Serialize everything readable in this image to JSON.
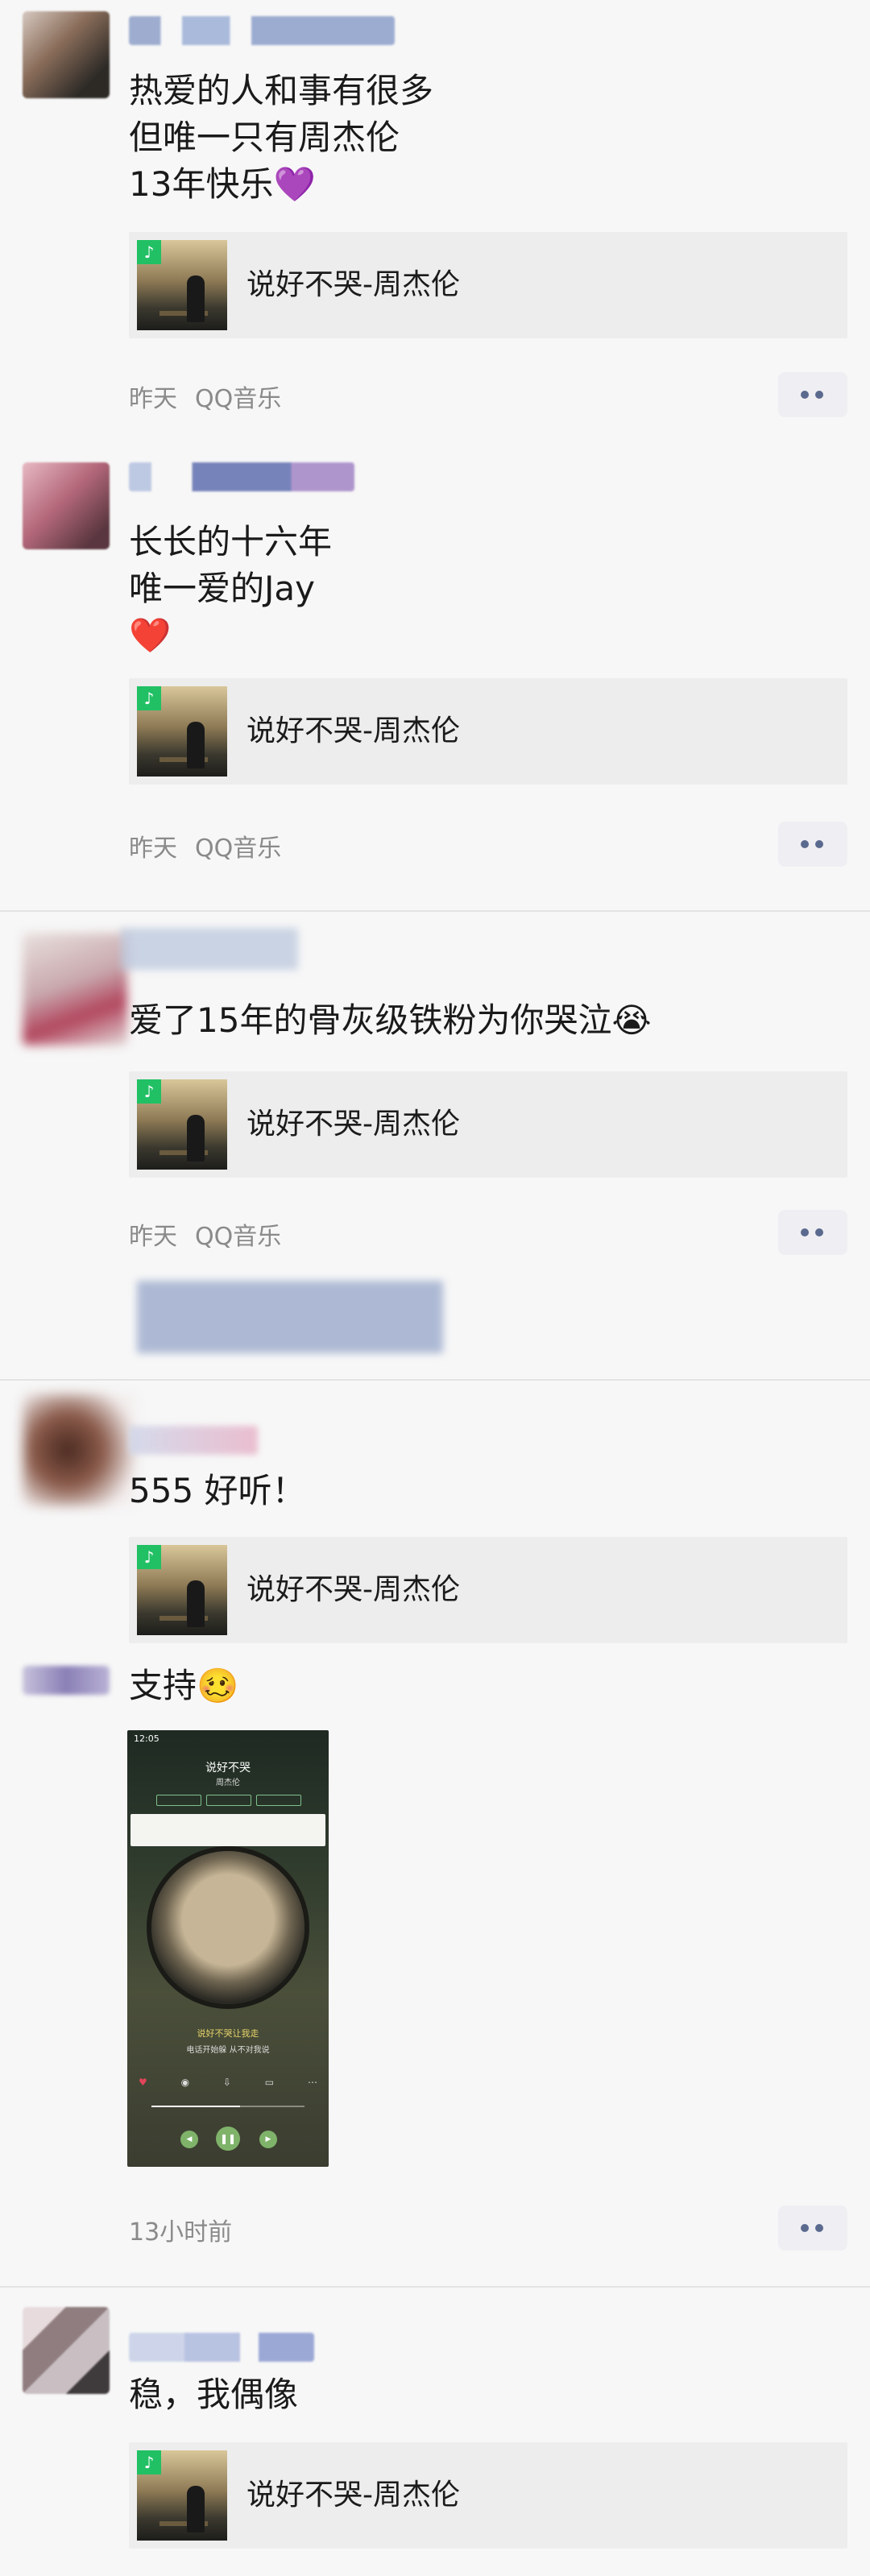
{
  "posts": [
    {
      "text": "热爱的人和事有很多\n但唯一只有周杰伦\n13年快乐💜",
      "card_title": "说好不哭-周杰伦",
      "time": "昨天",
      "source": "QQ音乐"
    },
    {
      "text": "长长的十六年\n唯一爱的Jay\n❤️",
      "card_title": "说好不哭-周杰伦",
      "time": "昨天",
      "source": "QQ音乐"
    },
    {
      "text": "爱了15年的骨灰级铁粉为你哭泣😭",
      "card_title": "说好不哭-周杰伦",
      "time": "昨天",
      "source": "QQ音乐"
    },
    {
      "text": "555 好听！",
      "card_title": "说好不哭-周杰伦"
    },
    {
      "text": "支持🥴",
      "time": "13小时前",
      "screenshot": {
        "status_time": "12:05",
        "song_title": "说好不哭",
        "artist": "周杰伦",
        "lyric_line1": "说好不哭让我走",
        "lyric_line2": "电话开始躲 从不对我说"
      }
    },
    {
      "text": "稳，我偶像",
      "card_title": "说好不哭-周杰伦"
    }
  ],
  "icons": {
    "more": "more-dots-icon",
    "music_badge": "qq-music-icon"
  },
  "colors": {
    "background": "#f7f7f7",
    "card": "#ededed",
    "meta_text": "#8a8a8a",
    "more_dots": "#5a6a8e"
  }
}
